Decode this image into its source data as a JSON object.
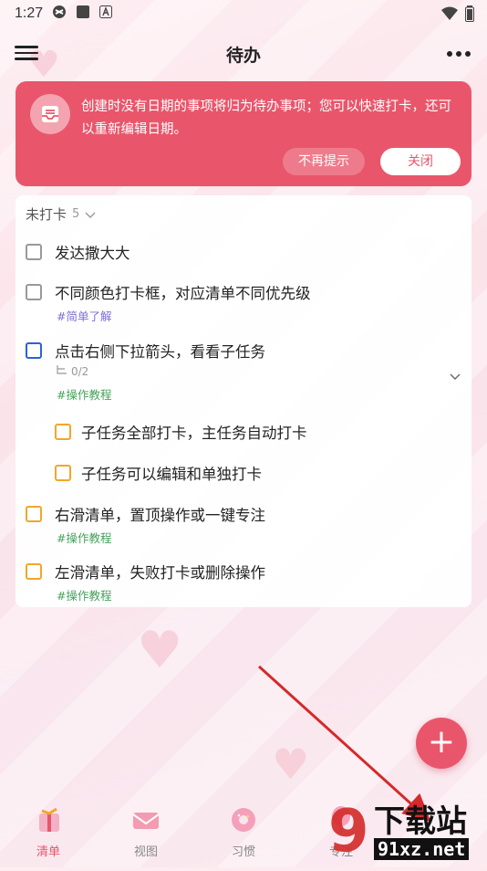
{
  "status_bar": {
    "time": "1:27"
  },
  "header": {
    "title": "待办"
  },
  "banner": {
    "message": "创建时没有日期的事项将归为待办事项；您可以快速打卡，还可以重新编辑日期。",
    "dismiss_forever_label": "不再提示",
    "close_label": "关闭"
  },
  "list": {
    "group_title": "未打卡",
    "group_count": "5",
    "tasks": [
      {
        "title": "发达撒大大"
      },
      {
        "title": "不同颜色打卡框，对应清单不同优先级",
        "tag": "#简单了解"
      },
      {
        "title": "点击右侧下拉箭头，看看子任务",
        "subtask_count": "0/2",
        "tag": "#操作教程"
      },
      {
        "title": "子任务全部打卡，主任务自动打卡"
      },
      {
        "title": "子任务可以编辑和单独打卡"
      },
      {
        "title": "右滑清单，置顶操作或一键专注",
        "tag": "#操作教程"
      },
      {
        "title": "左滑清单，失败打卡或删除操作",
        "tag": "#操作教程"
      }
    ]
  },
  "fab": {
    "label": "+"
  },
  "tabs": [
    {
      "label": "清单",
      "icon": "gift-list-icon"
    },
    {
      "label": "视图",
      "icon": "envelope-view-icon"
    },
    {
      "label": "习惯",
      "icon": "donut-habit-icon"
    },
    {
      "label": "专注",
      "icon": "balloon-focus-icon"
    }
  ],
  "watermark": {
    "text": "下载站",
    "url_text": "91xz.net"
  },
  "colors": {
    "accent": "#e9566b",
    "priority_none": "#999999",
    "priority_high": "#2a62d6",
    "priority_mid": "#f1a72a",
    "tag_green": "#44a25a",
    "tag_purple": "#7a6fd6"
  }
}
